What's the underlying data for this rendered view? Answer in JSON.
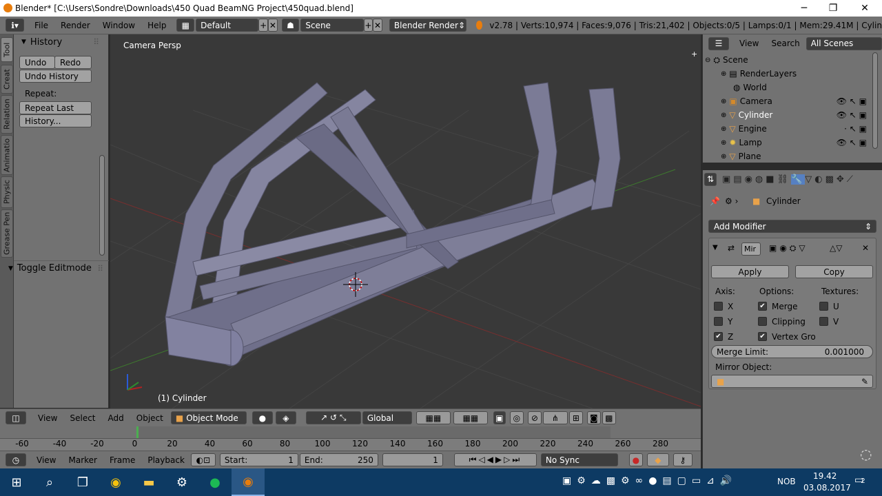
{
  "window": {
    "title": "Blender* [C:\\Users\\Sondre\\Downloads\\450 Quad BeamNG Project\\450quad.blend]",
    "minimize": "─",
    "restore": "❐",
    "close": "✕"
  },
  "menu": {
    "items": [
      "File",
      "Render",
      "Window",
      "Help"
    ],
    "layout": "Default",
    "scene": "Scene",
    "engine": "Blender Render",
    "stats": "v2.78 | Verts:10,974 | Faces:9,076 | Tris:21,402 | Objects:0/5 | Lamps:0/1 | Mem:29.41M | Cylin"
  },
  "tabs": [
    "Tool",
    "Creat",
    "Relation",
    "Animatio",
    "Physic",
    "Grease Pen"
  ],
  "shelf": {
    "history_title": "History",
    "undo": "Undo",
    "redo": "Redo",
    "undo_history": "Undo History",
    "repeat_label": "Repeat:",
    "repeat_last": "Repeat Last",
    "history_btn": "History...",
    "toggle_editmode": "Toggle Editmode"
  },
  "viewport": {
    "label": "Camera Persp",
    "object_label": "(1) Cylinder"
  },
  "view3d_header": {
    "view": "View",
    "select": "Select",
    "add": "Add",
    "object": "Object",
    "mode": "Object Mode",
    "orientation": "Global"
  },
  "timeline": {
    "ticks": [
      "-60",
      "-40",
      "-20",
      "0",
      "20",
      "40",
      "60",
      "80",
      "100",
      "120",
      "140",
      "160",
      "180",
      "200",
      "220",
      "240",
      "260",
      "280"
    ],
    "view": "View",
    "marker": "Marker",
    "frame": "Frame",
    "playback": "Playback",
    "start_label": "Start:",
    "start": "1",
    "end_label": "End:",
    "end": "250",
    "current": "1",
    "sync": "No Sync"
  },
  "outliner": {
    "view": "View",
    "search": "Search",
    "filter": "All Scenes",
    "rows": [
      {
        "name": "Scene",
        "indent": 0
      },
      {
        "name": "RenderLayers",
        "indent": 1
      },
      {
        "name": "World",
        "indent": 1
      },
      {
        "name": "Camera",
        "indent": 1
      },
      {
        "name": "Cylinder",
        "indent": 1
      },
      {
        "name": "Engine",
        "indent": 1
      },
      {
        "name": "Lamp",
        "indent": 1
      },
      {
        "name": "Plane",
        "indent": 1
      }
    ]
  },
  "properties": {
    "object": "Cylinder",
    "add_modifier": "Add Modifier",
    "mod_name": "Mir",
    "apply": "Apply",
    "copy": "Copy",
    "axis": "Axis:",
    "options": "Options:",
    "textures": "Textures:",
    "x": "X",
    "y": "Y",
    "z": "Z",
    "merge": "Merge",
    "clipping": "Clipping",
    "vertex_groups": "Vertex Gro",
    "u": "U",
    "v": "V",
    "merge_limit_label": "Merge Limit:",
    "merge_limit": "0.001000",
    "mirror_object": "Mirror Object:"
  },
  "tray": {
    "lang": "NOB",
    "time": "19.42",
    "date": "03.08.2017",
    "notif": "2"
  }
}
